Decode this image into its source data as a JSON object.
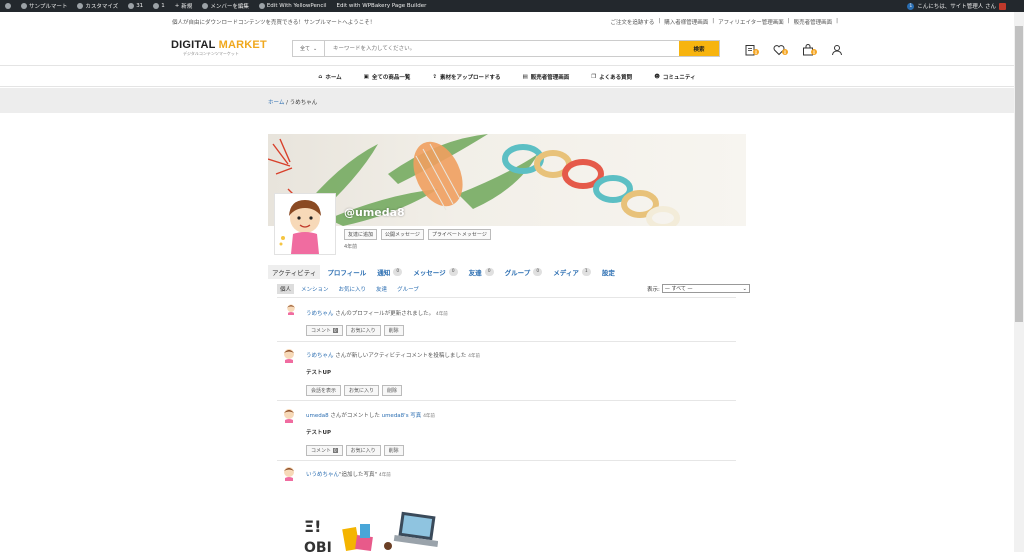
{
  "admin_bar": {
    "site_name": "サンプルマート",
    "customize": "カスタマイズ",
    "updates": "31",
    "comments": "1",
    "new": "新規",
    "edit_members": "メンバーを編集",
    "yellowpencil": "Edit With YellowPencil",
    "wpbakery": "Edit with WPBakery Page Builder",
    "notif": "1",
    "greeting": "こんにちは、サイト管理人 さん"
  },
  "top": {
    "welcome": "個人が自由にダウンロードコンテンツを売買できる！サンプルマートへようこそ！",
    "links": [
      "ご注文を追跡する",
      "|",
      "購入者様管理画面",
      "|",
      "アフィリエイター管理画面",
      "|",
      "販売者管理画面",
      "|"
    ]
  },
  "header": {
    "logo_main": "DIGITAL ",
    "logo_accent": "MARKET",
    "logo_sub": "デジタルコンテンツマーケット",
    "search_category": "全て",
    "search_placeholder": "キーワードを入力してください。",
    "search_button": "検索",
    "badges": {
      "orders": "0",
      "wishlist": "0",
      "cart": "0"
    }
  },
  "nav": [
    "ホーム",
    "全ての商品一覧",
    "素材をアップロードする",
    "販売者管理画面",
    "よくある質問",
    "コミュニティ"
  ],
  "breadcrumb": {
    "home": "ホーム",
    "sep": "/",
    "current": "うめちゃん"
  },
  "profile": {
    "handle": "@umeda8",
    "buttons": [
      "友達に追加",
      "公開メッセージ",
      "プライベートメッセージ"
    ],
    "active_time": "4年前"
  },
  "tabs": [
    {
      "label": "アクティビティ",
      "count": null
    },
    {
      "label": "プロフィール",
      "count": null
    },
    {
      "label": "通知",
      "count": "0"
    },
    {
      "label": "メッセージ",
      "count": "0"
    },
    {
      "label": "友達",
      "count": "0"
    },
    {
      "label": "グループ",
      "count": "0"
    },
    {
      "label": "メディア",
      "count": "1"
    },
    {
      "label": "設定",
      "count": null
    }
  ],
  "subtabs": [
    "個人",
    "メンション",
    "お気に入り",
    "友達",
    "グループ"
  ],
  "filter": {
    "label": "表示:",
    "value": "— すべて —"
  },
  "activities": [
    {
      "who": "うめちゃん",
      "text": " さんのプロフィールが更新されました。",
      "time": "4年前",
      "body": "",
      "buttons": [
        "コメント",
        "お気に入り",
        "削除"
      ],
      "comment_count": "0"
    },
    {
      "who": "うめちゃん",
      "text": " さんが新しいアクティビティコメントを投稿しました",
      "time": "4年前",
      "body": "テストUP",
      "buttons": [
        "会話を表示",
        "お気に入り",
        "削除"
      ],
      "comment_count": ""
    },
    {
      "who": "umeda8",
      "text": " さんがコメントした ",
      "who2": "umeda8's 写真",
      "time": "4年前",
      "body": "テストUP",
      "buttons": [
        "コメント",
        "お気に入り",
        "削除"
      ],
      "comment_count": "0"
    },
    {
      "who": "いうめちゃん",
      "text": "\"追加した写真\"",
      "time": "4年前",
      "body": "",
      "buttons": [],
      "comment_count": ""
    }
  ],
  "colors": {
    "accent": "#f7b40f",
    "link": "#2a6db1",
    "adminbar": "#23282d"
  }
}
